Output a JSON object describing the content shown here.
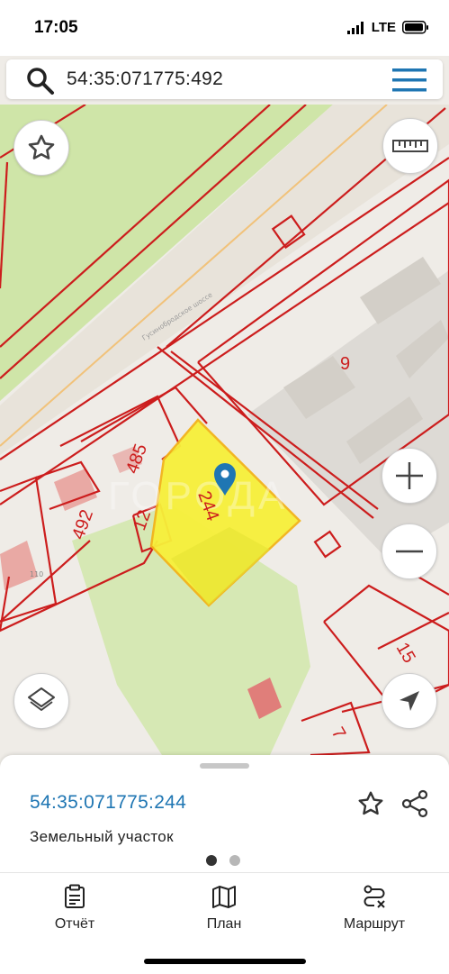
{
  "status_bar": {
    "time": "17:05",
    "network": "LTE"
  },
  "search": {
    "query": "54:35:071775:492"
  },
  "map": {
    "labels": {
      "street": "Гусинобродское шоссе",
      "lot_244": "244",
      "lot_485": "485",
      "lot_492": "492",
      "lot_12": "12",
      "lot_9": "9",
      "lot_15": "15",
      "lot_7": "7",
      "lot_110": "110"
    },
    "watermark": "ГОРОДА",
    "colors": {
      "boundary": "#cc1d1d",
      "selected_fill": "#f7f03a",
      "park": "#cfe5a8"
    }
  },
  "map_controls": {
    "favorite": "star-icon",
    "ruler": "ruler-icon",
    "zoom_in": "plus-icon",
    "zoom_out": "minus-icon",
    "layers": "layers-icon",
    "locate": "navigation-arrow-icon"
  },
  "sheet": {
    "cadastral_number": "54:35:071775:244",
    "object_type": "Земельный участок",
    "pages": 2,
    "active_page": 1
  },
  "tabs": [
    {
      "label": "Отчёт",
      "icon": "report-icon"
    },
    {
      "label": "План",
      "icon": "map-plan-icon"
    },
    {
      "label": "Маршрут",
      "icon": "route-icon"
    }
  ]
}
